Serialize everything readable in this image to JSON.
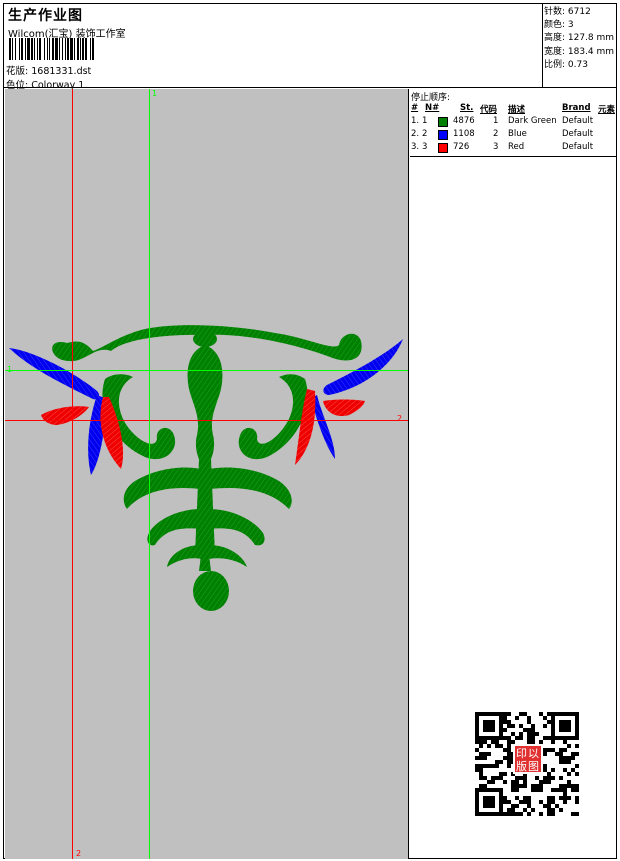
{
  "header": {
    "title": "生产作业图",
    "studio": "Wilcom(汇宝) 装饰工作室",
    "pattern_label": "花版:",
    "pattern_value": "1681331.dst",
    "color_label": "色位:",
    "color_value": "Colorway 1"
  },
  "stats": {
    "stitches": "针数: 6712",
    "colors": "颜色: 3",
    "height": "高度: 127.8 mm",
    "width": "宽度: 183.4 mm",
    "scale": "比例: 0.73"
  },
  "guides": {
    "green_v": "1",
    "green_h": "1",
    "red_v": "2",
    "red_h": "2"
  },
  "color_table": {
    "stop_title": "停止顺序:",
    "headers": {
      "num": "#",
      "n": "N#",
      "st": "St.",
      "code": "代码",
      "desc": "描述",
      "brand": "Brand",
      "element": "元素"
    },
    "rows": [
      {
        "num": "1.",
        "n": "1",
        "color": "#008000",
        "st": "4876",
        "code": "1",
        "desc": "Dark Green",
        "brand": "Default"
      },
      {
        "num": "2.",
        "n": "2",
        "color": "#0000ff",
        "st": "1108",
        "code": "2",
        "desc": "Blue",
        "brand": "Default"
      },
      {
        "num": "3.",
        "n": "3",
        "color": "#ff0000",
        "st": "726",
        "code": "3",
        "desc": "Red",
        "brand": "Default"
      }
    ]
  },
  "qr_stamp": {
    "chars": [
      "以",
      "图",
      "印",
      "版"
    ]
  },
  "colors": {
    "canvas_bg": "#c0c0c0",
    "guide_green": "#00ff00",
    "guide_red": "#ff0000"
  }
}
